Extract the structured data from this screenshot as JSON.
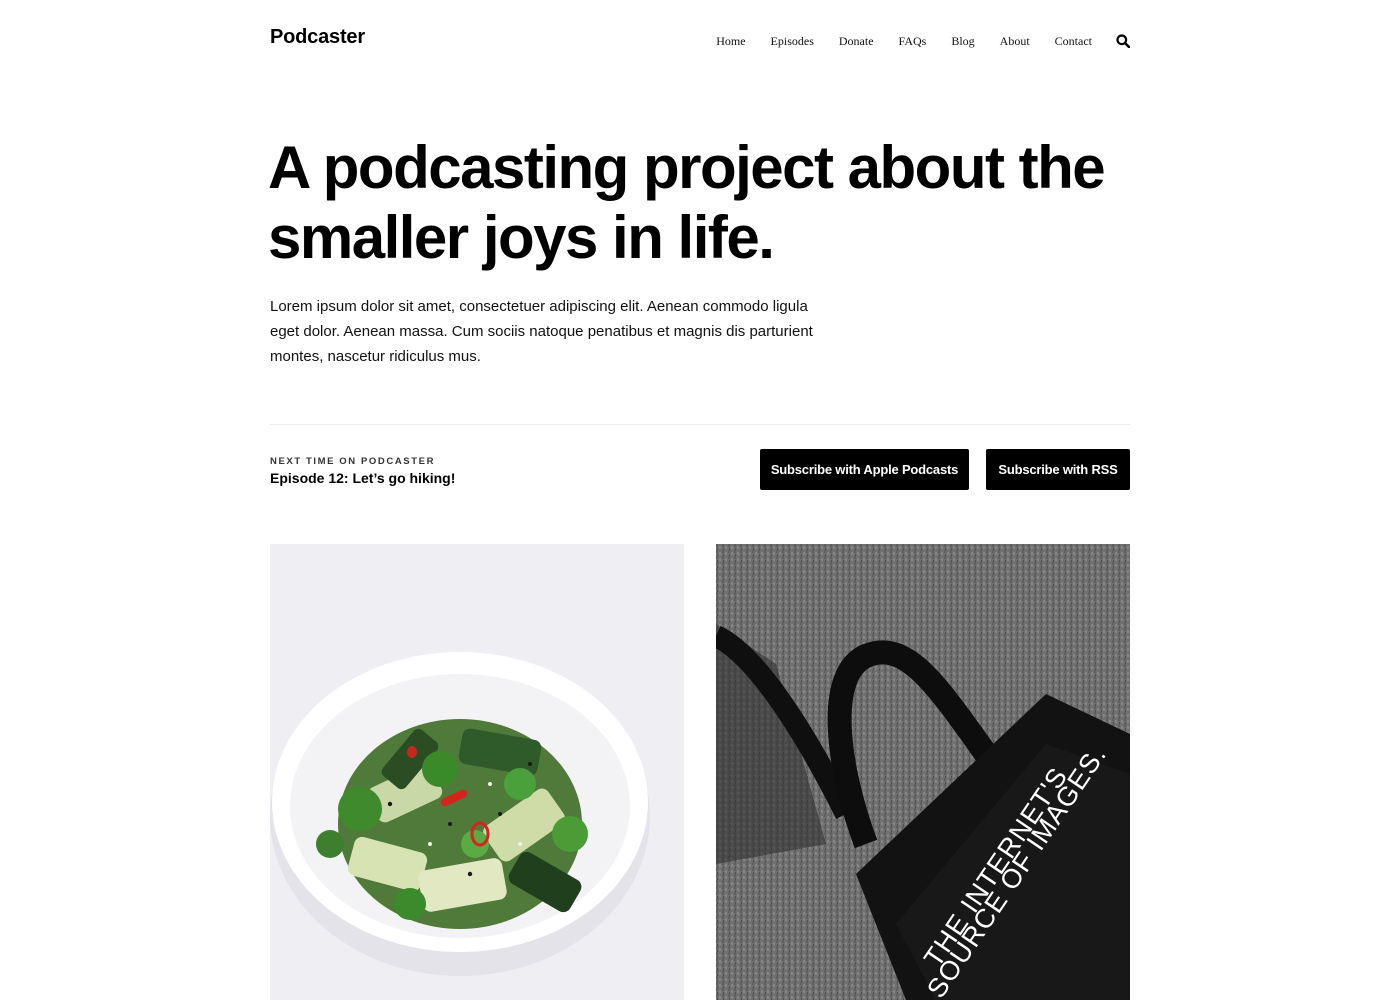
{
  "site": {
    "title": "Podcaster"
  },
  "nav": {
    "items": [
      {
        "label": "Home"
      },
      {
        "label": "Episodes"
      },
      {
        "label": "Donate"
      },
      {
        "label": "FAQs"
      },
      {
        "label": "Blog"
      },
      {
        "label": "About"
      },
      {
        "label": "Contact"
      }
    ],
    "search_icon": "search-icon"
  },
  "hero": {
    "title": "A podcasting project about the smaller joys in life.",
    "description": "Lorem ipsum dolor sit amet, consectetuer adipiscing elit. Aenean commodo ligula eget dolor. Aenean massa. Cum sociis natoque penatibus et magnis dis parturient montes, nascetur ridiculus mus."
  },
  "next": {
    "label": "NEXT TIME ON PODCASTER",
    "episode": "Episode 12: Let’s go hiking!"
  },
  "buttons": {
    "apple": "Subscribe with Apple Podcasts",
    "rss": "Subscribe with RSS"
  },
  "cards": {
    "right_bag_text_line1": "THE INTERNET'S",
    "right_bag_text_line2": "SOURCE OF IMAGES."
  },
  "colors": {
    "text": "#000000",
    "button_bg": "#000000",
    "button_text": "#ffffff",
    "divider": "#ececec"
  }
}
